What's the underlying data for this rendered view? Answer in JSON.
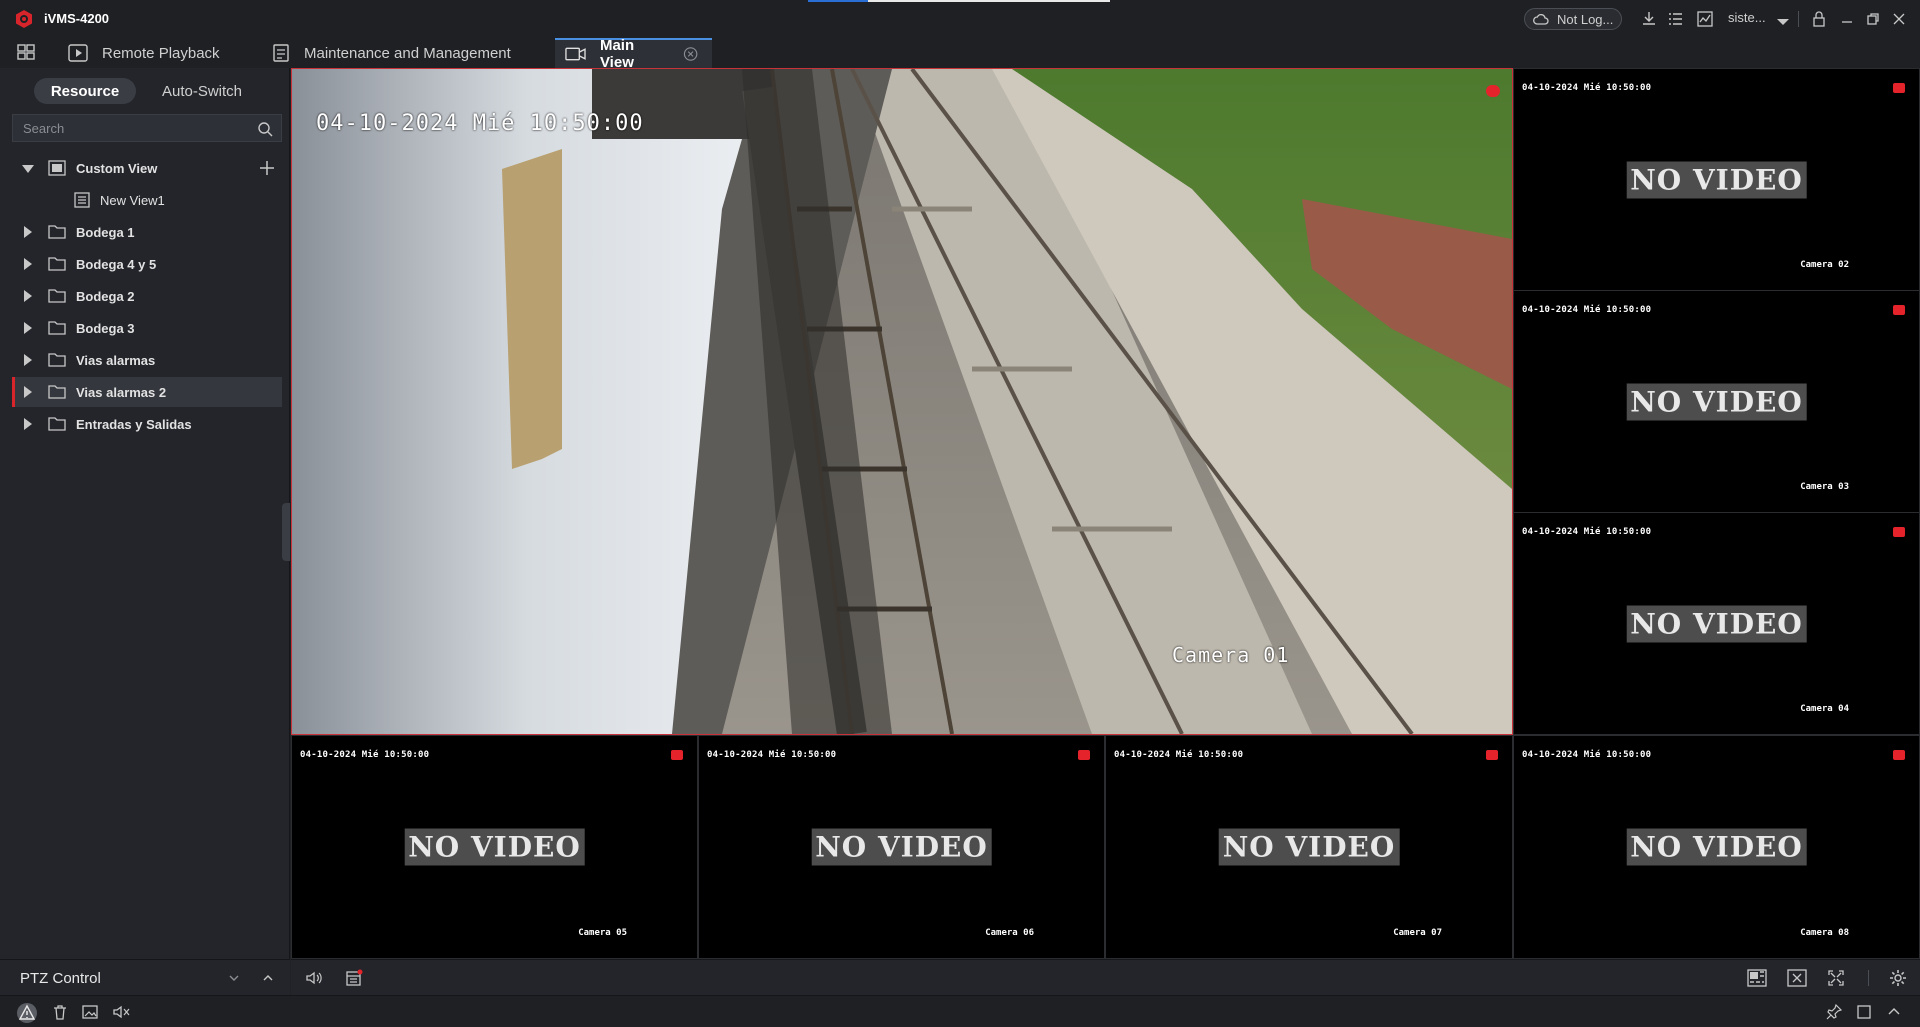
{
  "app": {
    "title": "iVMS-4200",
    "loading_progress": 0.2
  },
  "tabs": [
    {
      "label": "Remote Playback",
      "icon": "playback-icon"
    },
    {
      "label": "Maintenance and Management",
      "icon": "maintenance-icon"
    },
    {
      "label": "Main View",
      "icon": "camera-icon",
      "active": true
    }
  ],
  "topbar": {
    "cloud_status": "Not Log...",
    "user": "siste..."
  },
  "sidebar": {
    "segments": [
      "Resource",
      "Auto-Switch"
    ],
    "search_placeholder": "Search",
    "tree": [
      {
        "label": "Custom View",
        "expanded": true
      },
      {
        "label": "New View1",
        "child": true
      },
      {
        "label": "Bodega 1"
      },
      {
        "label": "Bodega 4 y 5"
      },
      {
        "label": "Bodega 2"
      },
      {
        "label": "Bodega 3"
      },
      {
        "label": "Vias alarmas"
      },
      {
        "label": "Vias alarmas 2",
        "selected": true
      },
      {
        "label": "Entradas y Salidas"
      }
    ],
    "ptz_label": "PTZ Control"
  },
  "views": {
    "main": {
      "timestamp": "04-10-2024 Mié  10:50:00",
      "camera": "Camera 01"
    },
    "tiles": [
      {
        "timestamp": "04-10-2024 Mié  10:50:00",
        "status": "NO VIDEO",
        "camera": "Camera 02"
      },
      {
        "timestamp": "04-10-2024 Mié  10:50:00",
        "status": "NO VIDEO",
        "camera": "Camera 03"
      },
      {
        "timestamp": "04-10-2024 Mié  10:50:00",
        "status": "NO VIDEO",
        "camera": "Camera 04"
      },
      {
        "timestamp": "04-10-2024 Mié  10:50:00",
        "status": "NO VIDEO",
        "camera": "Camera 05"
      },
      {
        "timestamp": "04-10-2024 Mié  10:50:00",
        "status": "NO VIDEO",
        "camera": "Camera 06"
      },
      {
        "timestamp": "04-10-2024 Mié  10:50:00",
        "status": "NO VIDEO",
        "camera": "Camera 07"
      },
      {
        "timestamp": "04-10-2024 Mié  10:50:00",
        "status": "NO VIDEO",
        "camera": "Camera 08"
      }
    ]
  },
  "colors": {
    "accent": "#d8242b",
    "active_tab": "#2d3036",
    "rec": "#e4232b"
  }
}
